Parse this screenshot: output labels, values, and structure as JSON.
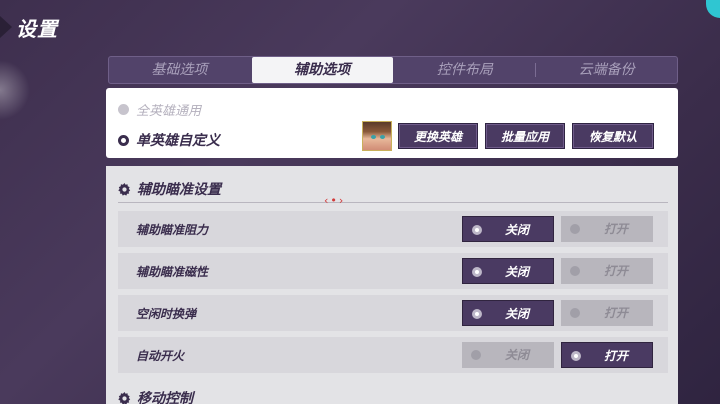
{
  "header": {
    "title": "设置"
  },
  "tabs": [
    {
      "label": "基础选项",
      "active": false
    },
    {
      "label": "辅助选项",
      "active": true
    },
    {
      "label": "控件布局",
      "active": false
    },
    {
      "label": "云端备份",
      "active": false
    }
  ],
  "hero_scope": {
    "option_all": "全英雄通用",
    "option_single": "单英雄自定义",
    "selected": "option_single",
    "buttons": {
      "change_hero": "更换英雄",
      "batch_apply": "批量应用",
      "restore_default": "恢复默认"
    }
  },
  "sections": {
    "aim_assist": {
      "title": "辅助瞄准设置",
      "rows": [
        {
          "label": "辅助瞄准阻力",
          "off_label": "关闭",
          "on_label": "打开",
          "value": "off"
        },
        {
          "label": "辅助瞄准磁性",
          "off_label": "关闭",
          "on_label": "打开",
          "value": "off"
        },
        {
          "label": "空闲时换弹",
          "off_label": "关闭",
          "on_label": "打开",
          "value": "off"
        },
        {
          "label": "自动开火",
          "off_label": "关闭",
          "on_label": "打开",
          "value": "on"
        }
      ]
    },
    "movement": {
      "title": "移动控制"
    }
  },
  "colors": {
    "accent_dark": "#4a3a62",
    "background": "#3e2f4e",
    "corner_accent": "#2fc6d2"
  }
}
